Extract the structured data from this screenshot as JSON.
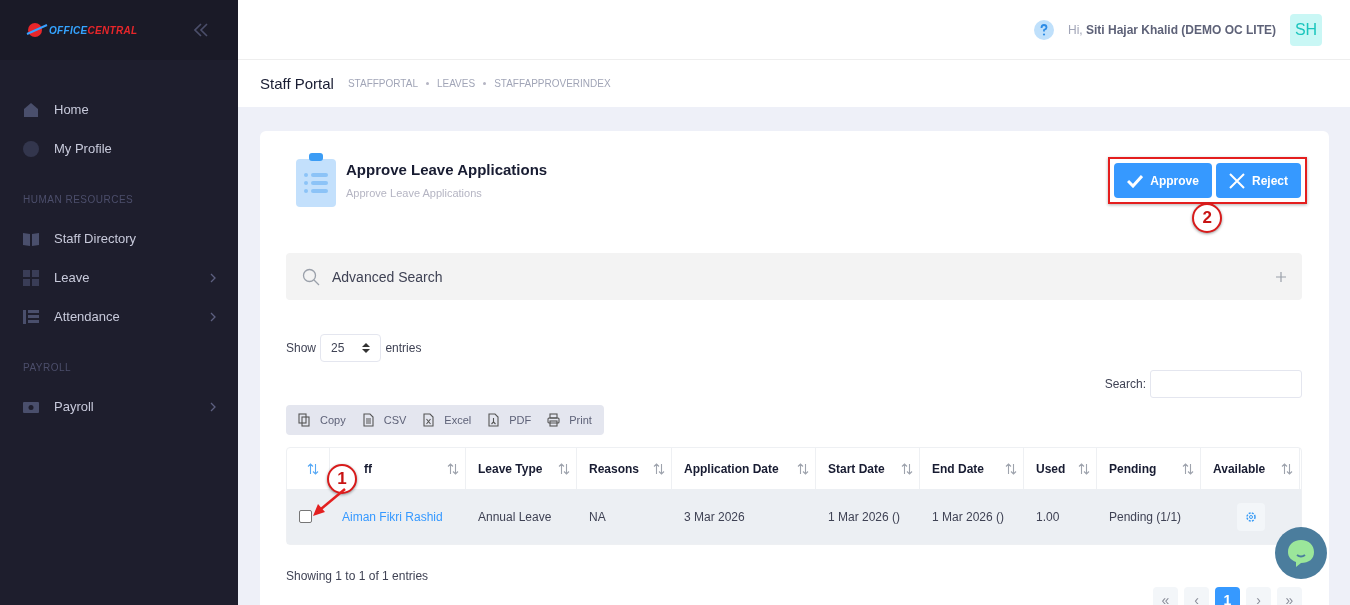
{
  "sidebar": {
    "logo": {
      "part_1": "OFFICE",
      "part_2": "CENTRAL"
    },
    "sections": [
      {
        "items": [
          {
            "label": "Home",
            "expandable": false
          },
          {
            "label": "My Profile",
            "expandable": false
          }
        ]
      },
      {
        "heading": "HUMAN RESOURCES",
        "items": [
          {
            "label": "Staff Directory",
            "expandable": false
          },
          {
            "label": "Leave",
            "expandable": true
          },
          {
            "label": "Attendance",
            "expandable": true
          }
        ]
      },
      {
        "heading": "PAYROLL",
        "items": [
          {
            "label": "Payroll",
            "expandable": true
          }
        ]
      }
    ]
  },
  "topbar": {
    "greeting": "Hi,",
    "user": "Siti Hajar Khalid (DEMO OC LITE)",
    "avatar": "SH"
  },
  "breadcrumb": {
    "title": "Staff Portal",
    "items": [
      "STAFFPORTAL",
      "LEAVES",
      "STAFFAPPROVERINDEX"
    ]
  },
  "card": {
    "title": "Approve Leave Applications",
    "subtitle": "Approve Leave Applications",
    "actions": [
      {
        "kind": "approve",
        "label": "Approve"
      },
      {
        "kind": "reject",
        "label": "Reject"
      }
    ],
    "advanced_search": "Advanced Search",
    "length": {
      "before": "Show",
      "value": "25",
      "after": "entries"
    },
    "search_label": "Search:",
    "export_buttons": [
      {
        "kind": "copy",
        "label": "Copy"
      },
      {
        "kind": "csv",
        "label": "CSV"
      },
      {
        "kind": "excel",
        "label": "Excel"
      },
      {
        "kind": "pdf",
        "label": "PDF"
      },
      {
        "kind": "print",
        "label": "Print"
      }
    ],
    "table": {
      "columns": [
        {
          "sorted": true
        },
        {
          "label": "ff",
          "sorted": false
        },
        {
          "label": "Leave Type",
          "sorted": false
        },
        {
          "label": "Reasons",
          "sorted": false
        },
        {
          "label": "Application Date",
          "sorted": false
        },
        {
          "label": "Start Date",
          "sorted": false
        },
        {
          "label": "End Date",
          "sorted": false
        },
        {
          "label": "Used",
          "sorted": false
        },
        {
          "label": "Pending",
          "sorted": false
        },
        {
          "label": "Available",
          "sorted": false
        }
      ],
      "rows": [
        {
          "checked": false,
          "cells": [
            "",
            "Aiman Fikri Rashid",
            "Annual Leave",
            "NA",
            "3 Mar 2026",
            "1 Mar 2026 ()",
            "1 Mar 2026 ()",
            "1.00",
            "Pending (1/1)"
          ]
        }
      ]
    },
    "info": "Showing 1 to 1 of 1 entries",
    "pagination": [
      {
        "label": "«",
        "selected": false
      },
      {
        "label": "‹",
        "selected": false
      },
      {
        "label": "1",
        "selected": true
      },
      {
        "label": "›",
        "selected": false
      },
      {
        "label": "»",
        "selected": false
      }
    ]
  },
  "annotations": [
    {
      "label": "1"
    },
    {
      "label": "2"
    }
  ]
}
